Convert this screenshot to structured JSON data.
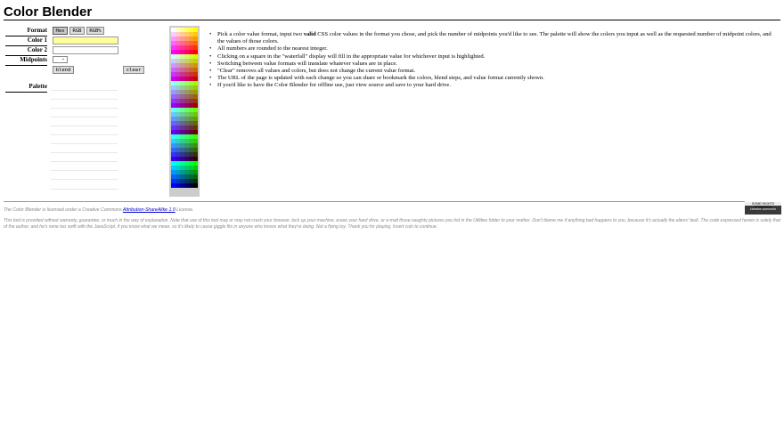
{
  "title": "Color Blender",
  "form": {
    "format_label": "Format",
    "format_options": [
      "Hex",
      "RGB",
      "RGB%"
    ],
    "color1_label": "Color 1",
    "color2_label": "Color 2",
    "midpoints_label": "Midpoints",
    "blend_label": "blend",
    "clear_label": "clear",
    "palette_label": "Palette"
  },
  "instructions": {
    "li1_pre": "Pick a color value format, input two ",
    "li1_bold": "valid",
    "li1_post": " CSS color values in the format you chose, and pick the number of midpoints you'd like to see. The palette will show the colors you input as well as the requested number of midpoint colors, and the values of those colors.",
    "li2": "All numbers are rounded to the nearest integer.",
    "li3": "Clicking on a square in the \"waterfall\" display will fill in the appropriate value for whichever input is highlighted.",
    "li4": "Switching between value formats will translate whatever values are in place.",
    "li5": "\"Clear\" removes all values and colors, but does not change the current value format.",
    "li6": "The URL of the page is updated with each change so you can share or bookmark the colors, blend steps, and value format currently shown.",
    "li7": "If you'd like to have the Color Blender for offline use, just view source and save to your hard drive."
  },
  "footer": {
    "license_pre": "The Color Blender is licensed under a Creative Commons ",
    "license_link": "Attribution-ShareAlike 1.0",
    "license_post": " License.",
    "disclaimer": "This tool is provided without warranty, guarantee, or much in the way of explanation. Note that use of this tool may or may not crash your browser, lock up your machine, erase your hard drive, or e-mail those naughty pictures you hid in the Utilities folder to your mother. Don't blame me if anything bad happens to you, because it's actually the aliens' fault. The code expressed herein is solely that of the author, and he's none too swift with the JavaScript, if you know what we mean, so it's likely to cause giggle fits in anyone who knows what they're doing. Not a flying toy. Thank you for playing. Insert coin to continue.",
    "cc_badge_top": "SOME RIGHTS RESERVED",
    "cc_badge_main": "creative commons"
  },
  "colors": {
    "color1_field_bg": "#ffff99",
    "link": "#0000cc"
  }
}
